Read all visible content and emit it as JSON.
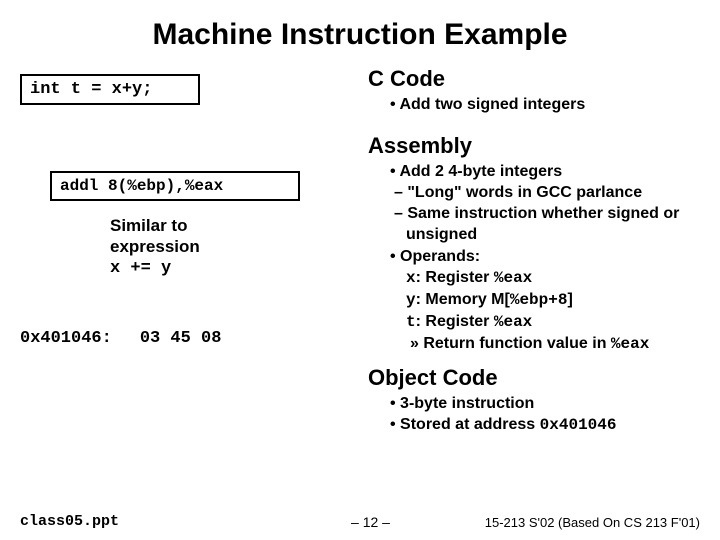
{
  "title": "Machine Instruction Example",
  "left": {
    "c_code": "int t = x+y;",
    "asm_code": "addl 8(%ebp),%eax",
    "similar_l1": "Similar to",
    "similar_l2": "expression",
    "similar_l3": "x += y",
    "obj_addr": "0x401046:",
    "obj_bytes": "03 45 08"
  },
  "sections": {
    "c": {
      "heading": "C Code",
      "b1": "• Add two signed integers"
    },
    "asm": {
      "heading": "Assembly",
      "b1": "• Add 2 4-byte integers",
      "b1a": "– \"Long\" words in GCC parlance",
      "b1b": "– Same instruction whether signed or unsigned",
      "b2": "• Operands:",
      "op_x_pre": "x",
      "op_x_mid": ": Register ",
      "op_x_val": "%eax",
      "op_y_pre": "y",
      "op_y_mid": ": Memory M[",
      "op_y_val": "%ebp+8",
      "op_y_suf": "]",
      "op_t_pre": "t",
      "op_t_mid": ": Register ",
      "op_t_val": "%eax",
      "ret": "» Return function value in ",
      "ret_reg": "%eax"
    },
    "obj": {
      "heading": "Object Code",
      "b1": "• 3-byte instruction",
      "b2_pre": "• Stored at address ",
      "b2_addr": "0x401046"
    }
  },
  "footer": {
    "cls": "class05.ppt",
    "page": "– 12 –",
    "course": "15-213 S'02 (Based On CS 213 F'01)"
  }
}
